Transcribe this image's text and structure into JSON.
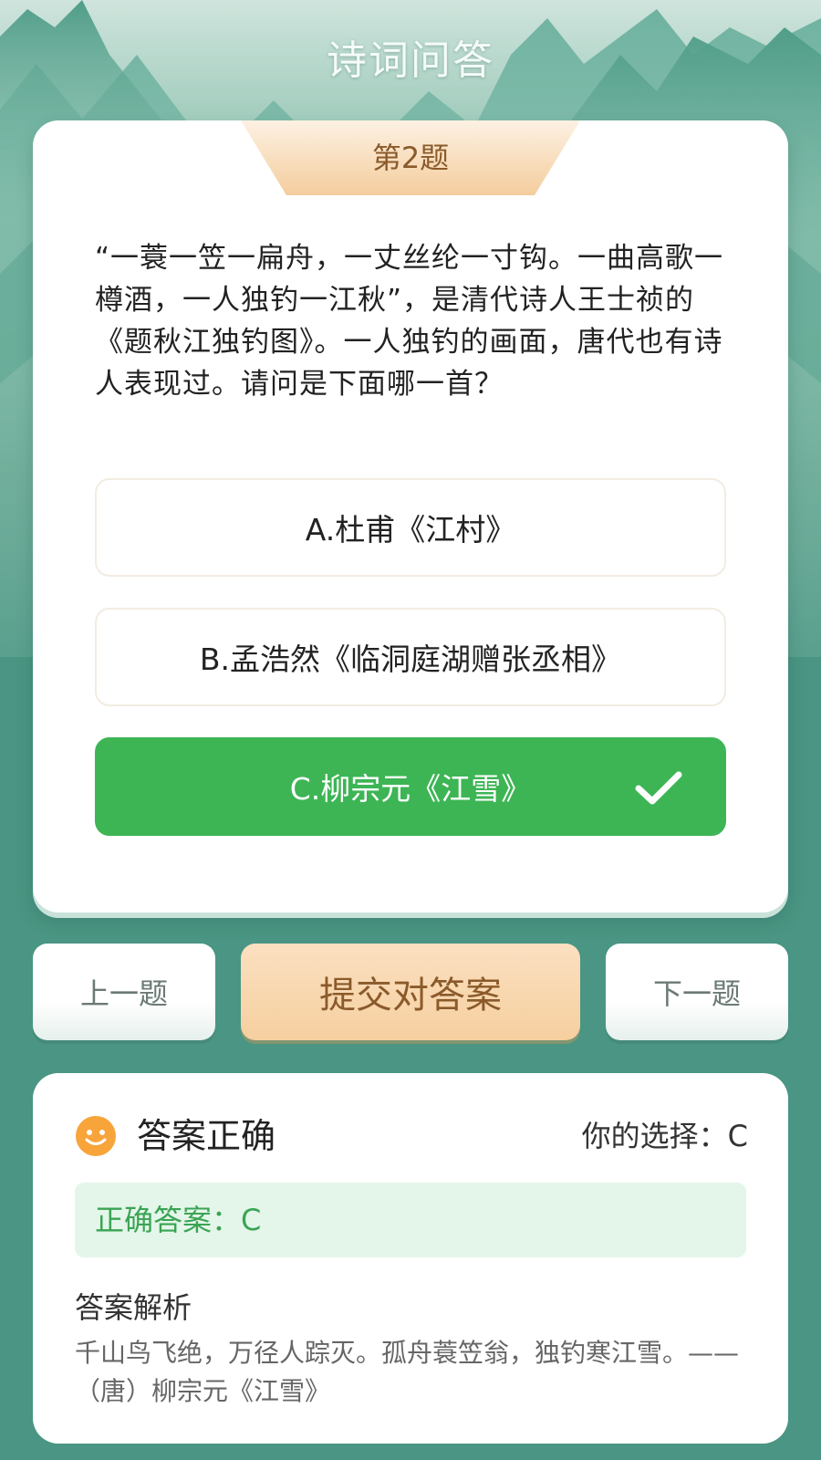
{
  "header": {
    "title": "诗词问答"
  },
  "question": {
    "badge": "第2题",
    "text": "“一蓑一笠一扁舟，一丈丝纶一寸钩。一曲高歌一樽酒，一人独钓一江秋”，是清代诗人王士祯的《题秋江独钓图》。一人独钓的画面，唐代也有诗人表现过。请问是下面哪一首？",
    "options": [
      {
        "label": "A.杜甫《江村》",
        "selected": false
      },
      {
        "label": "B.孟浩然《临洞庭湖赠张丞相》",
        "selected": false
      },
      {
        "label": "C.柳宗元《江雪》",
        "selected": true
      }
    ]
  },
  "actions": {
    "prev_label": "上一题",
    "submit_label": "提交对答案",
    "next_label": "下一题"
  },
  "result": {
    "status": "答案正确",
    "your_choice": "你的选择：C",
    "correct_answer": "正确答案：C",
    "analysis_title": "答案解析",
    "analysis_text": "千山鸟飞绝，万径人踪灭。孤舟蓑笠翁，独钓寒江雪。——（唐）柳宗元《江雪》"
  },
  "colors": {
    "accent_green": "#3db555",
    "badge_orange": "#f6cf9f",
    "background_teal": "#4a9583"
  },
  "icons": {
    "check": "check-icon",
    "smile": "smile-icon"
  }
}
